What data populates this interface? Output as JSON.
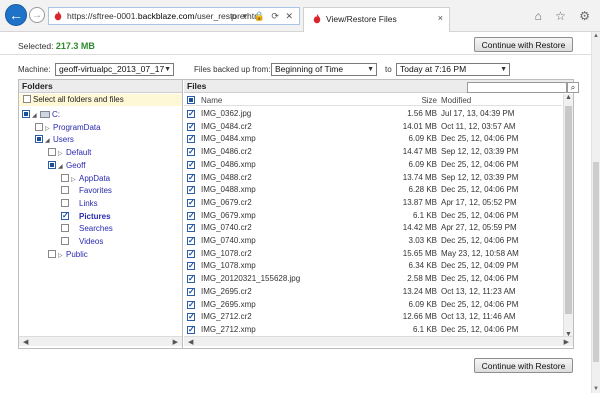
{
  "browser": {
    "url_prefix": "https://sftree-0001.",
    "url_domain": "backblaze.com",
    "url_path": "/user_restore.htm",
    "address_tools": "ρ ▾ 🔒 ⟳ ✕",
    "tab_title": "View/Restore Files",
    "tab_close": "×",
    "window_icons": "⌂ ☆ ⚙"
  },
  "header": {
    "selected_label": "Selected:",
    "selected_size": "217.3 MB",
    "continue_label": "Continue with Restore"
  },
  "filters": {
    "machine_label": "Machine:",
    "machine_value": "geoff-virtualpc_2013_07_17",
    "backed_up_label": "Files backed up from:",
    "from_value": "Beginning of Time",
    "to_label": "to",
    "to_value": "Today at 7:16 PM"
  },
  "folders": {
    "header": "Folders",
    "select_all": "Select all folders and files",
    "tree": [
      {
        "label": "C:",
        "state": "blue",
        "twisty": "◢"
      },
      {
        "label": "ProgramData",
        "state": "empty",
        "twisty": "▷"
      },
      {
        "label": "Users",
        "state": "blue",
        "twisty": "◢"
      },
      {
        "label": "Default",
        "state": "empty",
        "twisty": "▷"
      },
      {
        "label": "Geoff",
        "state": "blue",
        "twisty": "◢"
      },
      {
        "label": "AppData",
        "state": "empty",
        "twisty": "▷"
      },
      {
        "label": "Favorites",
        "state": "empty",
        "twisty": ""
      },
      {
        "label": "Links",
        "state": "empty",
        "twisty": ""
      },
      {
        "label": "Pictures",
        "state": "checked",
        "twisty": ""
      },
      {
        "label": "Searches",
        "state": "empty",
        "twisty": ""
      },
      {
        "label": "Videos",
        "state": "empty",
        "twisty": ""
      },
      {
        "label": "Public",
        "state": "empty",
        "twisty": "▷"
      }
    ]
  },
  "files": {
    "header": "Files",
    "columns": {
      "name": "Name",
      "size": "Size",
      "modified": "Modified"
    },
    "rows": [
      {
        "name": "IMG_0362.jpg",
        "size": "1.56 MB",
        "modified": "Jul 17, 13, 04:39 PM"
      },
      {
        "name": "IMG_0484.cr2",
        "size": "14.01 MB",
        "modified": "Oct 11, 12, 03:57 AM"
      },
      {
        "name": "IMG_0484.xmp",
        "size": "6.09 KB",
        "modified": "Dec 25, 12, 04:06 PM"
      },
      {
        "name": "IMG_0486.cr2",
        "size": "14.47 MB",
        "modified": "Sep 12, 12, 03:39 PM"
      },
      {
        "name": "IMG_0486.xmp",
        "size": "6.09 KB",
        "modified": "Dec 25, 12, 04:06 PM"
      },
      {
        "name": "IMG_0488.cr2",
        "size": "13.74 MB",
        "modified": "Sep 12, 12, 03:39 PM"
      },
      {
        "name": "IMG_0488.xmp",
        "size": "6.28 KB",
        "modified": "Dec 25, 12, 04:06 PM"
      },
      {
        "name": "IMG_0679.cr2",
        "size": "13.87 MB",
        "modified": "Apr 17, 12, 05:52 PM"
      },
      {
        "name": "IMG_0679.xmp",
        "size": "6.1 KB",
        "modified": "Dec 25, 12, 04:06 PM"
      },
      {
        "name": "IMG_0740.cr2",
        "size": "14.42 MB",
        "modified": "Apr 27, 12, 05:59 PM"
      },
      {
        "name": "IMG_0740.xmp",
        "size": "3.03 KB",
        "modified": "Dec 25, 12, 04:06 PM"
      },
      {
        "name": "IMG_1078.cr2",
        "size": "15.65 MB",
        "modified": "May 23, 12, 10:58 AM"
      },
      {
        "name": "IMG_1078.xmp",
        "size": "6.34 KB",
        "modified": "Dec 25, 12, 04:09 PM"
      },
      {
        "name": "IMG_20120321_155628.jpg",
        "size": "2.58 MB",
        "modified": "Dec 25, 12, 04:06 PM"
      },
      {
        "name": "IMG_2695.cr2",
        "size": "13.24 MB",
        "modified": "Oct 13, 12, 11:23 AM"
      },
      {
        "name": "IMG_2695.xmp",
        "size": "6.09 KB",
        "modified": "Dec 25, 12, 04:06 PM"
      },
      {
        "name": "IMG_2712.cr2",
        "size": "12.66 MB",
        "modified": "Oct 13, 12, 11:46 AM"
      },
      {
        "name": "IMG_2712.xmp",
        "size": "6.1 KB",
        "modified": "Dec 25, 12, 04:06 PM"
      }
    ]
  },
  "colors": {
    "accent": "#1e73c8",
    "selected_size": "#2e8b2e",
    "select_all_bg": "#fff8d6"
  }
}
